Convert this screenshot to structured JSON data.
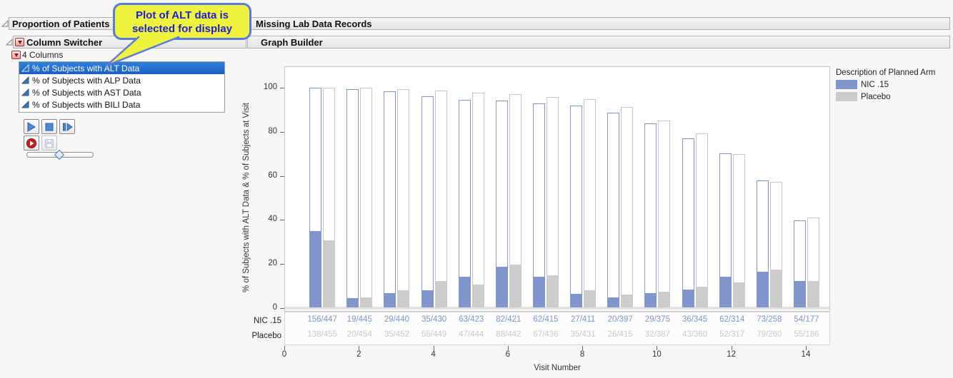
{
  "colors": {
    "nic_fill": "#8095cb",
    "nic_outline": "#8095cb",
    "nic_text": "#7e94c8",
    "placebo_fill": "#cccccc",
    "placebo_outline": "#c6c6c6",
    "placebo_text": "#c9c9c9",
    "selection_blue": "#2a6fd0",
    "callout_fill": "#eef43e",
    "callout_border": "#5b79de"
  },
  "window": {
    "title_left": "Proportion of Patients",
    "title_right": "Missing Lab Data Records"
  },
  "callout": {
    "line1": "Plot of ALT data is",
    "line2": "selected for display"
  },
  "column_switcher": {
    "header": "Column Switcher",
    "columns_label": "4 Columns",
    "items": [
      {
        "label": "% of Subjects with ALT Data",
        "selected": true
      },
      {
        "label": "% of Subjects with ALP Data",
        "selected": false
      },
      {
        "label": "% of Subjects with AST Data",
        "selected": false
      },
      {
        "label": "% of Subjects with BILI Data",
        "selected": false
      }
    ],
    "buttons": [
      "play",
      "stop",
      "step",
      "record",
      "save"
    ]
  },
  "graph_builder": {
    "header": "Graph Builder"
  },
  "chart_data": {
    "type": "bar",
    "title": "",
    "xlabel": "Visit Number",
    "ylabel": "% of Subjects with ALT Data & % of Subjects at Visit",
    "x_visits": [
      1,
      2,
      3,
      4,
      5,
      6,
      7,
      8,
      9,
      10,
      11,
      12,
      13,
      14
    ],
    "x_ticks": [
      0,
      2,
      4,
      6,
      8,
      10,
      12,
      14
    ],
    "y_ticks": [
      0,
      20,
      40,
      60,
      80,
      100
    ],
    "ylim": [
      0,
      110
    ],
    "grid": false,
    "legend": {
      "title": "Description of Planned Arm",
      "position": "right"
    },
    "note": "Each visit shows an outlined bar (% of subjects at visit) with a filled bar (% of subjects with ALT data); labels are n-with-data / n-at-visit",
    "series": [
      {
        "name": "NIC .15",
        "labels": [
          "156/447",
          "19/445",
          "29/440",
          "35/430",
          "63/423",
          "82/421",
          "62/415",
          "27/411",
          "20/397",
          "29/375",
          "36/345",
          "62/314",
          "73/258",
          "54/177"
        ],
        "pct_with_data": [
          34.7,
          4.2,
          6.5,
          7.8,
          14.0,
          18.3,
          13.8,
          6.0,
          4.5,
          6.5,
          8.0,
          13.8,
          16.3,
          12.0
        ],
        "pct_at_visit": [
          99.6,
          99.1,
          98.0,
          95.8,
          94.2,
          93.8,
          92.4,
          91.5,
          88.4,
          83.5,
          76.8,
          69.9,
          57.5,
          39.4
        ]
      },
      {
        "name": "Placebo",
        "labels": [
          "138/455",
          "20/454",
          "35/452",
          "55/449",
          "47/444",
          "88/442",
          "67/436",
          "35/431",
          "26/415",
          "32/387",
          "43/360",
          "52/317",
          "79/260",
          "55/186"
        ],
        "pct_with_data": [
          30.3,
          4.4,
          7.7,
          12.1,
          10.3,
          19.3,
          14.7,
          7.7,
          5.7,
          7.0,
          9.4,
          11.4,
          17.3,
          12.1
        ],
        "pct_at_visit": [
          99.8,
          99.6,
          99.1,
          98.5,
          97.4,
          96.9,
          95.6,
          94.5,
          91.0,
          84.9,
          78.9,
          69.5,
          57.0,
          40.8
        ]
      }
    ]
  }
}
